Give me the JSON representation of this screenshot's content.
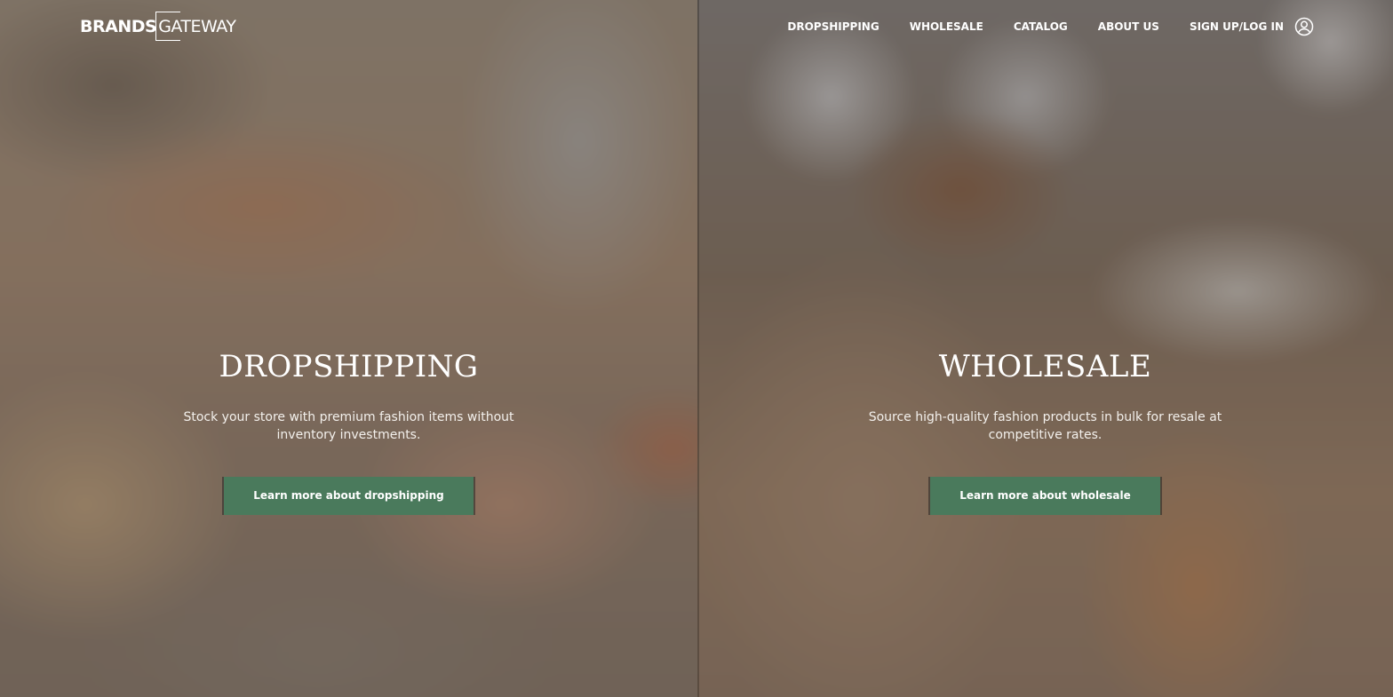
{
  "logo": {
    "brands": "BRANDS",
    "gateway": "GATEWAY"
  },
  "nav": {
    "dropshipping": "DROPSHIPPING",
    "wholesale": "WHOLESALE",
    "catalog": "CATALOG",
    "about": "ABOUT US",
    "signup": "SIGN UP/LOG IN",
    "account_icon": "user-circle-icon"
  },
  "panels": {
    "dropshipping": {
      "title": "DROPSHIPPING",
      "description": "Stock your store with premium fashion items without inventory investments.",
      "button": "Learn more about dropshipping"
    },
    "wholesale": {
      "title": "WHOLESALE",
      "description": "Source high-quality fashion products in bulk for resale at competitive rates.",
      "button": "Learn more about wholesale"
    }
  },
  "colors": {
    "button_bg": "#4a7a5c",
    "text": "#ffffff"
  }
}
